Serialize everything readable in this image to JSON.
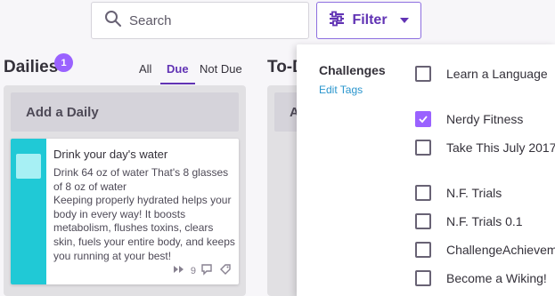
{
  "search": {
    "placeholder": "Search",
    "icon": "search-icon"
  },
  "filter": {
    "label": "Filter",
    "icon": "sliders-icon",
    "accent": "#6133b4"
  },
  "dailies": {
    "title": "Dailies",
    "badge": "1",
    "tabs": [
      {
        "label": "All",
        "active": false
      },
      {
        "label": "Due",
        "active": true
      },
      {
        "label": "Not Due",
        "active": false
      }
    ],
    "add_label": "Add a Daily",
    "card": {
      "title": "Drink your day's water",
      "notes": "Drink 64 oz of water That's 8 glasses of 8 oz of water\nKeeping properly hydrated helps your body in every way! It boosts metabolism, flushes toxins, clears skin, fuels your entire body, and keeps you running at your best!",
      "streak": "9",
      "color": "#20c9d6"
    }
  },
  "todos": {
    "title": "To-D",
    "add_label": "A"
  },
  "dropdown": {
    "heading": "Challenges",
    "edit_tags": "Edit Tags",
    "options": [
      {
        "label": "Learn a Language",
        "checked": false
      },
      {
        "label": "Nerdy Fitness",
        "checked": true
      },
      {
        "label": "Take This July 2017",
        "checked": false
      },
      {
        "label": "N.F. Trials",
        "checked": false
      },
      {
        "label": "N.F. Trials 0.1",
        "checked": false
      },
      {
        "label": "ChallengeAchievement",
        "checked": false
      },
      {
        "label": "Become a Wiking!",
        "checked": false
      }
    ]
  }
}
